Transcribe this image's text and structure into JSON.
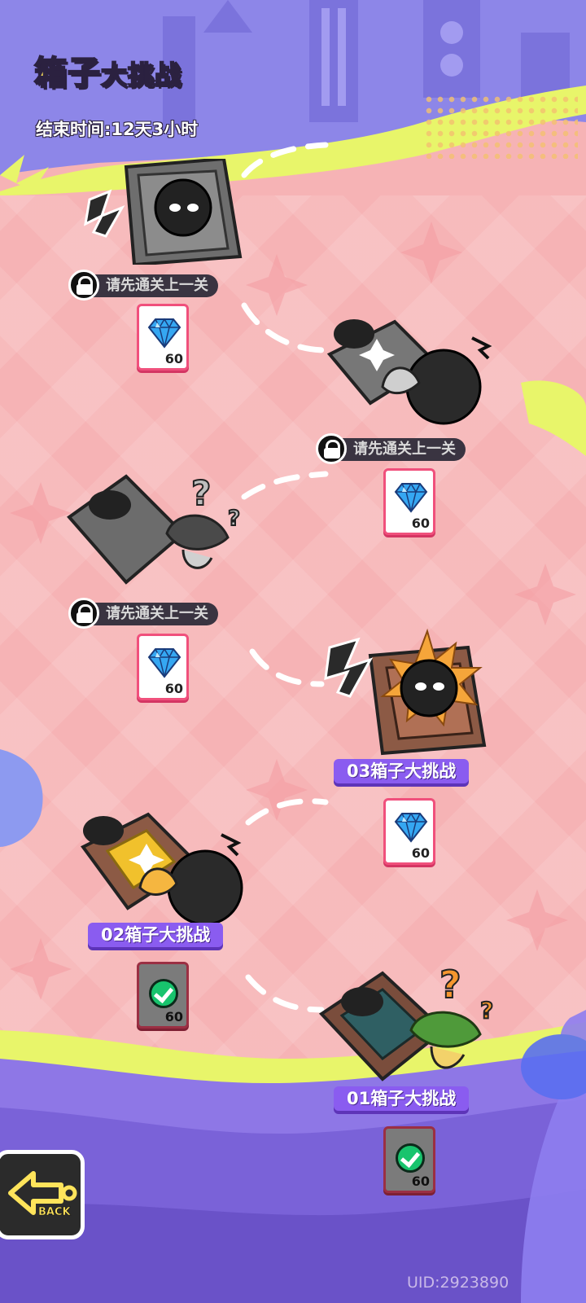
{
  "header": {
    "title_part1": "箱子",
    "title_part2": "大挑战",
    "end_time": "结束时间:12天3小时"
  },
  "colors": {
    "background": "#f6b3b5",
    "title_yellow": "#ffe45b",
    "tag_purple": "#8a5cf0",
    "reward_border": "#f0507c",
    "ground_purple": "#8e77e6",
    "lime": "#e8f56a"
  },
  "levels": [
    {
      "status": "locked",
      "lock_text": "请先通关上一关",
      "reward": {
        "icon": "blue-gem-icon",
        "amount": "60",
        "claimed": false
      }
    },
    {
      "status": "locked",
      "lock_text": "请先通关上一关",
      "reward": {
        "icon": "blue-gem-icon",
        "amount": "60",
        "claimed": false
      }
    },
    {
      "status": "locked",
      "lock_text": "请先通关上一关",
      "reward": {
        "icon": "blue-gem-icon",
        "amount": "60",
        "claimed": false
      }
    },
    {
      "status": "unlocked",
      "name": "03箱子大挑战",
      "reward": {
        "icon": "blue-gem-icon",
        "amount": "60",
        "claimed": false
      }
    },
    {
      "status": "cleared",
      "name": "02箱子大挑战",
      "reward": {
        "icon": "check-icon",
        "amount": "60",
        "claimed": true
      }
    },
    {
      "status": "cleared",
      "name": "01箱子大挑战",
      "reward": {
        "icon": "check-icon",
        "amount": "60",
        "claimed": true
      }
    }
  ],
  "back_button": {
    "label": "BACK",
    "icon": "back-arrow-icon"
  },
  "footer": {
    "uid": "UID:2923890"
  }
}
